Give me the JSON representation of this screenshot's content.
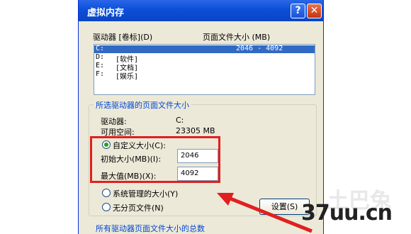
{
  "window": {
    "title": "虚拟内存",
    "help_icon": "?",
    "close_icon": "✕"
  },
  "drives": {
    "col_drive": "驱动器 [卷标](D)",
    "col_size": "页面文件大小 (MB)",
    "rows": [
      {
        "drive": "C:",
        "label": "",
        "size": "2046 - 4092",
        "selected": true
      },
      {
        "drive": "D:",
        "label": "[软件]",
        "size": ""
      },
      {
        "drive": "E:",
        "label": "[文档]",
        "size": ""
      },
      {
        "drive": "F:",
        "label": "[娱乐]",
        "size": ""
      }
    ]
  },
  "selected": {
    "group_title": "所选驱动器的页面文件大小",
    "drive_label": "驱动器:",
    "drive_value": "C:",
    "space_label": "可用空间:",
    "space_value": "23305 MB",
    "custom_label": "自定义大小(C):",
    "initial_label": "初始大小(MB)(I):",
    "initial_value": "2046",
    "max_label": "最大值(MB)(X):",
    "max_value": "4092",
    "system_label": "系统管理的大小(Y)",
    "nopage_label": "无分页文件(N)",
    "set_button": "设置(S)"
  },
  "bottom": {
    "group_title": "所有驱动器页面文件大小的总数"
  },
  "overlay": {
    "brand": "37uu.cn",
    "watermark": "土巴兔"
  },
  "colors": {
    "highlight": "#e02020",
    "selection": "#316ac5"
  }
}
